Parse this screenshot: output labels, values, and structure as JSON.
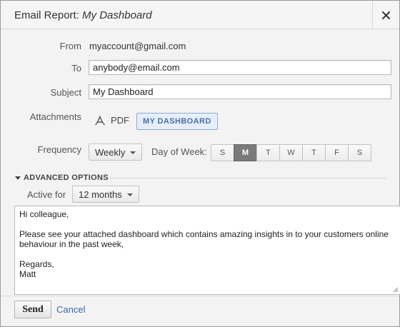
{
  "dialog": {
    "title_prefix": "Email Report:",
    "title_name": "My Dashboard",
    "close_icon": "close-icon"
  },
  "form": {
    "from_label": "From",
    "from_value": "myaccount@gmail.com",
    "to_label": "To",
    "to_value": "anybody@email.com",
    "subject_label": "Subject",
    "subject_value": "My Dashboard",
    "attachments_label": "Attachments",
    "attachment_icon": "pdf-icon",
    "attachment_format": "PDF",
    "attachment_chip": "MY DASHBOARD",
    "frequency_label": "Frequency",
    "frequency_value": "Weekly",
    "day_of_week_label": "Day of Week:",
    "days": [
      "S",
      "M",
      "T",
      "W",
      "T",
      "F",
      "S"
    ],
    "selected_day": "M"
  },
  "advanced": {
    "section_label": "ADVANCED OPTIONS",
    "active_for_label": "Active for",
    "active_for_value": "12 months"
  },
  "message": {
    "greeting": "Hi colleague,",
    "body": "Please see your attached dashboard which contains amazing insights in to your customers online behaviour in the past week,",
    "closing": "Regards,",
    "signature": "Matt"
  },
  "footer": {
    "send_label": "Send",
    "cancel_label": "Cancel"
  },
  "colors": {
    "link": "#3b6aa8",
    "chip_text": "#4b6fa8",
    "active_day": "#7a7a7a"
  }
}
